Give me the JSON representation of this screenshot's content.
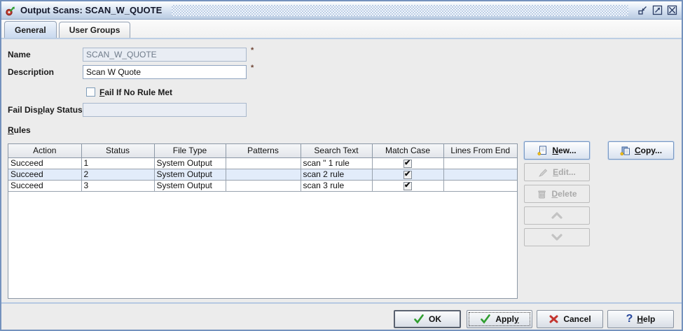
{
  "colors": {
    "ok_apply_check_green": "#2f9e2f",
    "cancel_x_red": "#c3352f",
    "help_question_blue": "#24459c",
    "selected_tab_blue": "#c9d9ee",
    "table_alt_row_blue": "#e2ecfa",
    "titlebar_blue": "#b9cbe2"
  },
  "window": {
    "title": "Output Scans: SCAN_W_QUOTE"
  },
  "tabs": {
    "general": "General",
    "user_groups": "User Groups"
  },
  "form": {
    "name_label": "Name",
    "name_value": "SCAN_W_QUOTE",
    "name_required": "*",
    "description_label": "Description",
    "description_value": "Scan W Quote",
    "description_required": "*",
    "fail_rule_checkbox": {
      "pre": "",
      "mn": "F",
      "post": "ail If No Rule Met",
      "checked": false
    },
    "fail_display_status": {
      "pre": "Fail Dis",
      "mn": "p",
      "post": "lay Status",
      "value": ""
    }
  },
  "rules": {
    "label": {
      "pre": "",
      "mn": "R",
      "post": "ules"
    },
    "columns": [
      "Action",
      "Status",
      "File Type",
      "Patterns",
      "Search Text",
      "Match Case",
      "Lines From End"
    ],
    "rows": [
      {
        "action": "Succeed",
        "status": "1",
        "file_type": "System Output",
        "patterns": "",
        "search_text": "scan \" 1 rule",
        "match_case": true,
        "lines_from_end": ""
      },
      {
        "action": "Succeed",
        "status": "2",
        "file_type": "System Output",
        "patterns": "",
        "search_text": "scan 2 rule",
        "match_case": true,
        "lines_from_end": ""
      },
      {
        "action": "Succeed",
        "status": "3",
        "file_type": "System Output",
        "patterns": "",
        "search_text": "scan 3 rule",
        "match_case": true,
        "lines_from_end": ""
      }
    ],
    "buttons": {
      "new": {
        "pre": "",
        "mn": "N",
        "post": "ew..."
      },
      "copy": {
        "pre": "",
        "mn": "C",
        "post": "opy..."
      },
      "edit": {
        "pre": "",
        "mn": "E",
        "post": "dit..."
      },
      "delete": {
        "pre": "",
        "mn": "D",
        "post": "elete"
      }
    }
  },
  "footer": {
    "ok": "OK",
    "apply": {
      "pre": "Appl",
      "mn": "y",
      "post": ""
    },
    "cancel": "Cancel",
    "help": {
      "pre": "",
      "mn": "H",
      "post": "elp"
    }
  }
}
